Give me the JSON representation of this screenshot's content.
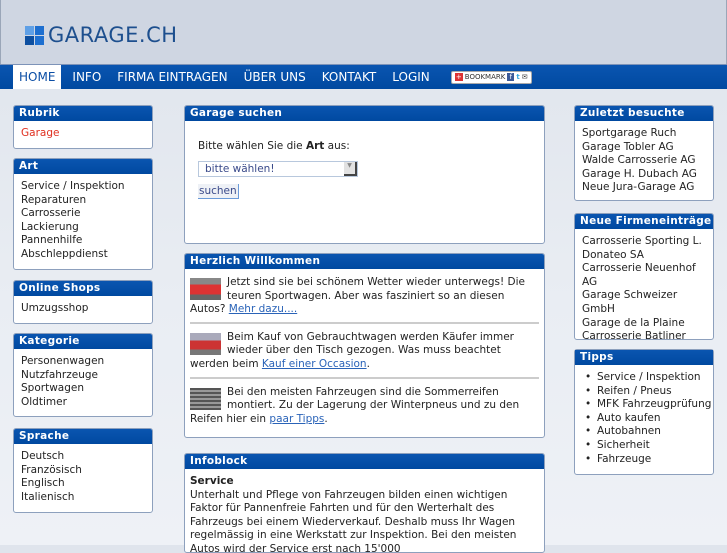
{
  "logo": {
    "text": "GARAGE.CH"
  },
  "nav": {
    "items": [
      "HOME",
      "INFO",
      "FIRMA EINTRAGEN",
      "ÜBER UNS",
      "KONTAKT",
      "LOGIN"
    ],
    "bookmark": "BOOKMARK"
  },
  "left": {
    "rubrik": {
      "title": "Rubrik",
      "items": [
        "Garage"
      ]
    },
    "art": {
      "title": "Art",
      "items": [
        "Service / Inspektion",
        "Reparaturen",
        "Carrosserie",
        "Lackierung",
        "Pannenhilfe",
        "Abschleppdienst"
      ]
    },
    "shops": {
      "title": "Online Shops",
      "items": [
        "Umzugsshop"
      ]
    },
    "kategorie": {
      "title": "Kategorie",
      "items": [
        "Personenwagen",
        "Nutzfahrzeuge",
        "Sportwagen",
        "Oldtimer"
      ]
    },
    "sprache": {
      "title": "Sprache",
      "items": [
        "Deutsch",
        "Französisch",
        "Englisch",
        "Italienisch"
      ]
    }
  },
  "search": {
    "title": "Garage suchen",
    "prompt_pre": "Bitte wählen Sie die ",
    "prompt_bold": "Art",
    "prompt_post": " aus:",
    "select_value": "bitte wählen!",
    "button": "suchen"
  },
  "welcome": {
    "title": "Herzlich Willkommen",
    "articles": [
      {
        "text": "Jetzt sind sie bei schönem Wetter wieder unterwegs! Die teuren Sportwagen. Aber was fasziniert so an diesen Autos? ",
        "link": "Mehr dazu....",
        "after": ""
      },
      {
        "text": "Beim Kauf von Gebrauchtwagen werden Käufer immer wieder über den Tisch gezogen. Was  muss beachtet werden beim ",
        "link": "Kauf einer Occasion",
        "after": "."
      },
      {
        "text": "Bei den meisten Fahrzeugen sind die Sommerreifen montiert. Zu der Lagerung der Winterpneus und zu den Reifen hier ein ",
        "link": "paar Tipps",
        "after": "."
      }
    ]
  },
  "info": {
    "title": "Infoblock",
    "heading": "Service",
    "text": "Unterhalt und Pflege von Fahrzeugen bilden einen wichtigen Faktor für Pannenfreie Fahrten und für den Werterhalt des Fahrzeugs bei einem Wiederverkauf. Deshalb muss Ihr Wagen regelmässig in eine Werkstatt zur Inspektion. Bei den meisten Autos wird der Service erst nach 15'000"
  },
  "right": {
    "recent": {
      "title": "Zuletzt besuchte",
      "items": [
        "Sportgarage Ruch",
        "Garage Tobler AG",
        "Walde Carrosserie AG",
        "Garage H. Dubach AG",
        "Neue Jura-Garage AG"
      ]
    },
    "new": {
      "title": "Neue Firmeneinträge",
      "items": [
        "Carrosserie Sporting L. Donateo SA",
        "Carrosserie Neuenhof AG",
        "Garage Schweizer GmbH",
        "Garage de la Plaine",
        "Carrosserie Batliner GmbH"
      ]
    },
    "tips": {
      "title": "Tipps",
      "items": [
        "Service / Inspektion",
        "Reifen / Pneus",
        "MFK Fahrzeugprüfung",
        "Auto kaufen",
        "Autobahnen",
        "Sicherheit",
        "Fahrzeuge"
      ]
    }
  }
}
